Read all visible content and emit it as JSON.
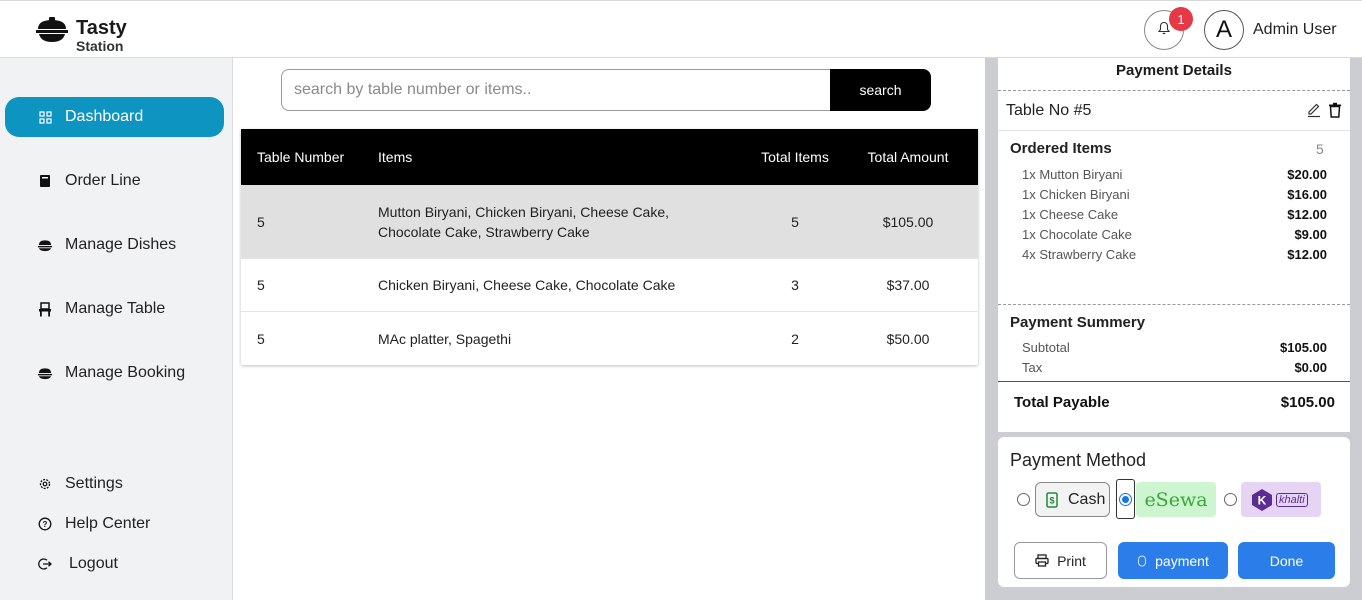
{
  "brand": {
    "name_line1": "Tasty",
    "name_line2": "Station"
  },
  "header": {
    "notification_count": "1",
    "avatar_letter": "A",
    "user_name": "Admin User"
  },
  "sidebar": {
    "items": [
      {
        "label": "Dashboard",
        "icon": "dashboard-icon",
        "active": true
      },
      {
        "label": "Order Line",
        "icon": "book-icon"
      },
      {
        "label": "Manage Dishes",
        "icon": "dish-icon"
      },
      {
        "label": "Manage Table",
        "icon": "chair-icon"
      },
      {
        "label": "Manage Booking",
        "icon": "dish-icon"
      }
    ],
    "bottom": [
      {
        "label": "Settings",
        "icon": "gear-icon"
      },
      {
        "label": "Help Center",
        "icon": "help-icon"
      },
      {
        "label": "Logout",
        "icon": "logout-icon"
      }
    ]
  },
  "search": {
    "placeholder": "search by table number or items..",
    "button": "search"
  },
  "orders_table": {
    "headers": [
      "Table Number",
      "Items",
      "Total Items",
      "Total Amount"
    ],
    "rows": [
      {
        "table": "5",
        "items": "Mutton Biryani, Chicken Biryani, Cheese Cake, Chocolate Cake, Strawberry Cake",
        "total_items": "5",
        "amount": "$105.00"
      },
      {
        "table": "5",
        "items": "Chicken Biryani, Cheese Cake, Chocolate Cake",
        "total_items": "3",
        "amount": "$37.00"
      },
      {
        "table": "5",
        "items": "MAc platter, Spagethi",
        "total_items": "2",
        "amount": "$50.00"
      }
    ]
  },
  "payment_details": {
    "title": "Payment Details",
    "table_no": "Table No #5",
    "ordered_items_title": "Ordered Items",
    "ordered_items_count": "5",
    "items": [
      {
        "name": "1x Mutton Biryani",
        "price": "$20.00"
      },
      {
        "name": "1x Chicken Biryani",
        "price": "$16.00"
      },
      {
        "name": "1x Cheese Cake",
        "price": "$12.00"
      },
      {
        "name": "1x Chocolate Cake",
        "price": "$9.00"
      },
      {
        "name": "4x Strawberry Cake",
        "price": "$12.00"
      }
    ],
    "summary_title": "Payment Summery",
    "subtotal_label": "Subtotal",
    "subtotal": "$105.00",
    "tax_label": "Tax",
    "tax": "$0.00",
    "total_label": "Total Payable",
    "total": "$105.00"
  },
  "payment_method": {
    "title": "Payment Method",
    "cash_label": "Cash",
    "esewa_label": "eSewa",
    "khalti_label": "khalti",
    "selected": "esewa",
    "print_label": "Print",
    "payment_label": "payment",
    "done_label": "Done"
  },
  "colors": {
    "accent": "#0d94c0",
    "primary_button": "#2b7de9",
    "badge": "#e63946"
  }
}
